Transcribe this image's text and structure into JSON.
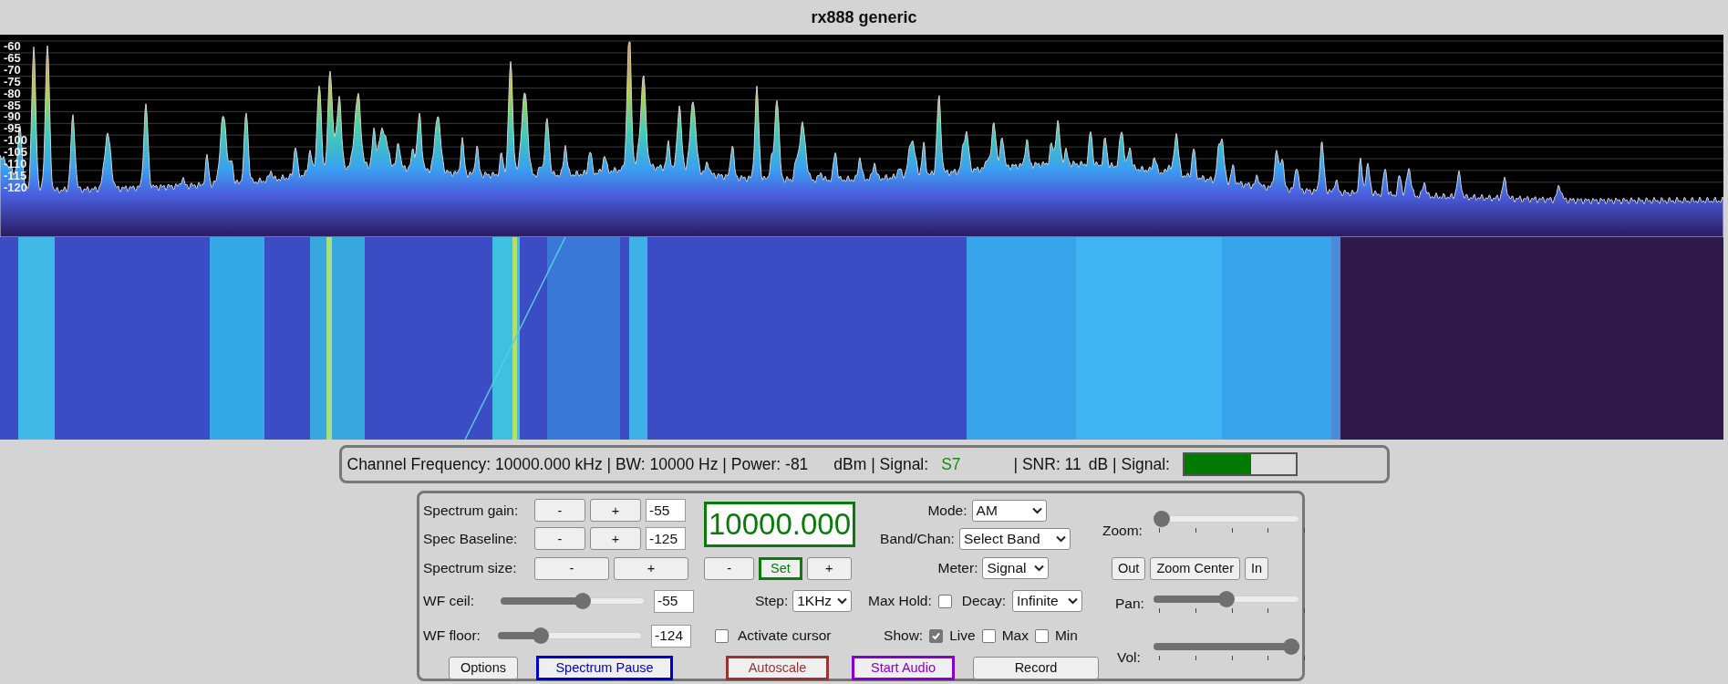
{
  "window": {
    "title": "rx888 generic"
  },
  "spectrum": {
    "y_labels": [
      "-60",
      "-65",
      "-70",
      "-75",
      "-80",
      "-85",
      "-90",
      "-95",
      "-100",
      "-105",
      "-110",
      "-115",
      "-120"
    ]
  },
  "status_bar": {
    "text": "Channel Frequency: 10000.000 kHz | BW: 10000 Hz | Power: -81",
    "power_unit": "dBm | Signal:",
    "s_meter": "S7",
    "snr": "| SNR: 11",
    "snr_unit": "dB | Signal:",
    "signal_meter": {
      "level": 0.6
    }
  },
  "spectrum_controls": [
    {
      "label": "Spectrum gain:",
      "minus": "-",
      "plus": "+",
      "value": "-55"
    },
    {
      "label": "Spec Baseline:",
      "minus": "-",
      "plus": "+",
      "value": "-125"
    }
  ],
  "spectrum_size": {
    "label": "Spectrum size:",
    "minus": "-",
    "plus": "+"
  },
  "tuning": {
    "frequency": "10000.000",
    "minus": "-",
    "set": "Set",
    "plus": "+",
    "step_label": "Step:",
    "step": "1KHz"
  },
  "waterfall_controls": [
    {
      "label": "WF ceil:",
      "level": 0.58,
      "value": "-55"
    },
    {
      "label": "WF floor:",
      "level": 0.27,
      "value": "-124"
    }
  ],
  "activate_cursor": {
    "label": "Activate cursor",
    "checked": false
  },
  "mode": {
    "label": "Mode:",
    "value": "AM"
  },
  "band": {
    "label": "Band/Chan:",
    "value": "Select Band"
  },
  "meter": {
    "label": "Meter:",
    "value": "Signal"
  },
  "max_hold": {
    "label": "Max Hold:",
    "checked": false
  },
  "decay": {
    "label": "Decay:",
    "value": "Infinite"
  },
  "show": {
    "label": "Show:",
    "options": [
      {
        "label": "Live",
        "checked": true
      },
      {
        "label": "Max",
        "checked": false
      },
      {
        "label": "Min",
        "checked": false
      }
    ]
  },
  "zoom": {
    "label": "Zoom:",
    "level": 0,
    "buttons": [
      "Out",
      "Zoom Center",
      "In"
    ]
  },
  "pan": {
    "label": "Pan:",
    "level": 0.5
  },
  "volume": {
    "label": "Vol:",
    "level": 1
  },
  "buttons": [
    {
      "label": "Options"
    },
    {
      "label": "Spectrum Pause",
      "color": "#0000cc"
    },
    {
      "label": "Autoscale",
      "color": "#993333"
    },
    {
      "label": "Start Audio",
      "color": "#8800cc"
    },
    {
      "label": "Record"
    }
  ]
}
